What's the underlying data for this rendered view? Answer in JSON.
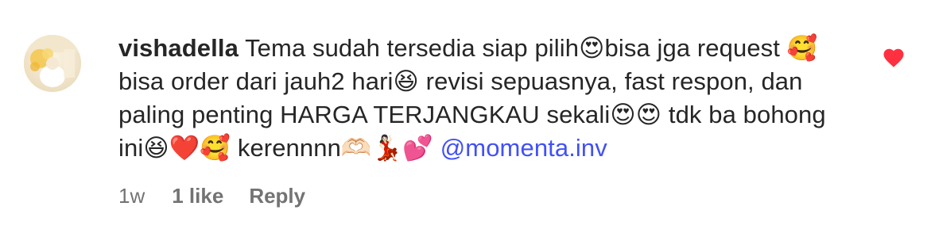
{
  "comment": {
    "username": "vishadella",
    "text": " Tema sudah tersedia siap pilih😍bisa jga request 🥰 bisa order dari jauh2 hari😆 revisi sepuasnya, fast respon, dan paling penting HARGA TERJANGKAU sekali😍😍 tdk ba bohong ini😆❤️🥰 kerennnn🫶🏻💃🏻💕 ",
    "mention": "@momenta.inv",
    "time": "1w",
    "likes": "1 like",
    "reply_label": "Reply",
    "liked": true
  },
  "colors": {
    "heart": "#ff3040",
    "mention": "#4150f7",
    "meta": "#737373",
    "text": "#262626"
  },
  "icons": {
    "like": "heart-filled-icon",
    "avatar": "profile-photo"
  }
}
